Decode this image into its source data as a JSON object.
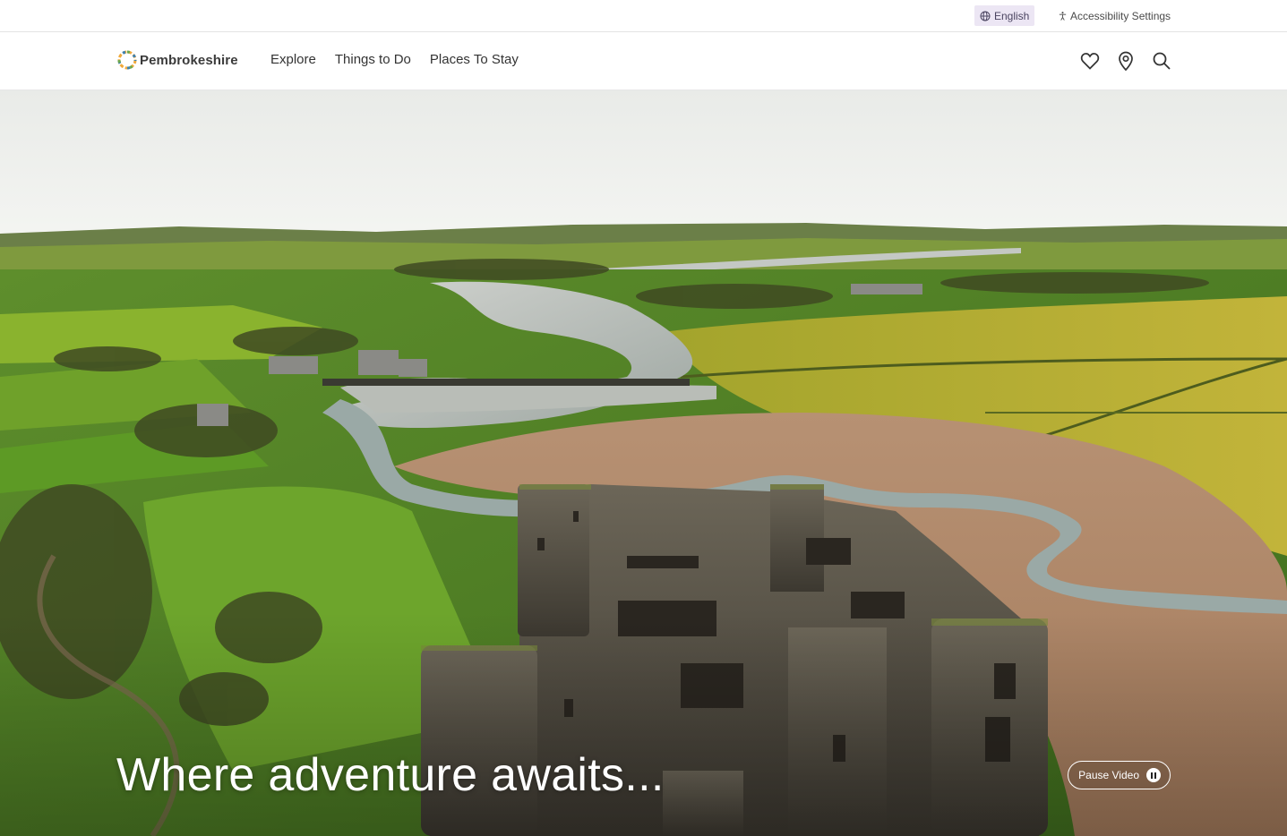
{
  "utility": {
    "language_label": "English",
    "accessibility_label": "Accessibility Settings"
  },
  "header": {
    "logo_text": "Pembrokeshire",
    "nav": [
      "Explore",
      "Things to Do",
      "Places To Stay"
    ],
    "icons": [
      "heart-icon",
      "map-pin-icon",
      "search-icon"
    ]
  },
  "hero": {
    "headline": "Where adventure awaits...",
    "pause_label": "Pause Video"
  },
  "colors": {
    "accent_lavender": "#ece6f4",
    "header_text": "#333333"
  }
}
